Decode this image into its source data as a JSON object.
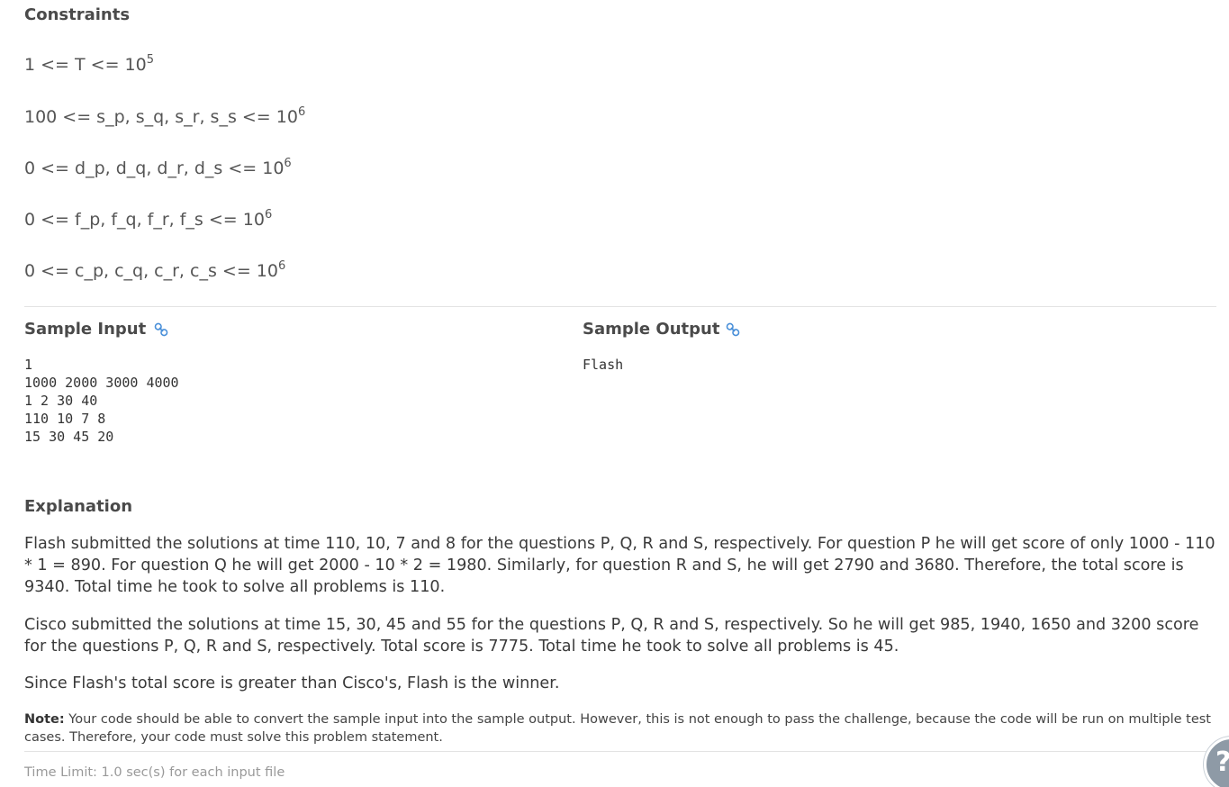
{
  "constraints": {
    "title": "Constraints",
    "items": [
      {
        "text": "1 <= T <= 10",
        "exp": "5"
      },
      {
        "text": "100 <= s_p, s_q, s_r, s_s <= 10",
        "exp": "6"
      },
      {
        "text": "0 <= d_p, d_q, d_r, d_s <= 10",
        "exp": "6"
      },
      {
        "text": "0 <= f_p, f_q, f_r, f_s <= 10",
        "exp": "6"
      },
      {
        "text": "0 <= c_p, c_q, c_r, c_s <= 10",
        "exp": "6"
      }
    ]
  },
  "sample_input": {
    "title": "Sample Input",
    "icon": "link-icon",
    "lines": [
      "1",
      "1000 2000 3000 4000",
      "1 2 30 40",
      "110 10 7 8",
      "15 30 45 20"
    ]
  },
  "sample_output": {
    "title": "Sample Output",
    "icon": "link-icon",
    "lines": [
      "Flash"
    ]
  },
  "explanation": {
    "title": "Explanation",
    "paragraphs": [
      "Flash submitted the solutions at time 110, 10, 7 and 8 for the questions P, Q, R and S, respectively. For question P he will get score of only 1000 - 110 * 1 = 890. For question Q he will get 2000 - 10 * 2 = 1980. Similarly, for question R and S, he will get 2790 and 3680. Therefore, the total score is 9340. Total time he took to solve all problems is 110.",
      "Cisco submitted the solutions at time 15, 30, 45 and 55 for the questions P, Q, R and S, respectively. So he will get 985, 1940, 1650 and 3200 score for the questions P, Q, R and S, respectively. Total score is 7775. Total time he took to solve all problems is 45.",
      "Since Flash's total score is greater than Cisco's, Flash is the winner."
    ]
  },
  "note": {
    "label": "Note:",
    "text": " Your code should be able to convert the sample input into the sample output. However, this is not enough to pass the challenge, because the code will be run on multiple test cases. Therefore, your code must solve this problem statement."
  },
  "time_limit": "Time Limit: 1.0 sec(s) for each input file",
  "help": {
    "icon": "help-icon",
    "glyph": "?"
  },
  "colors": {
    "accent": "#4a90d9",
    "muted": "#999999"
  }
}
